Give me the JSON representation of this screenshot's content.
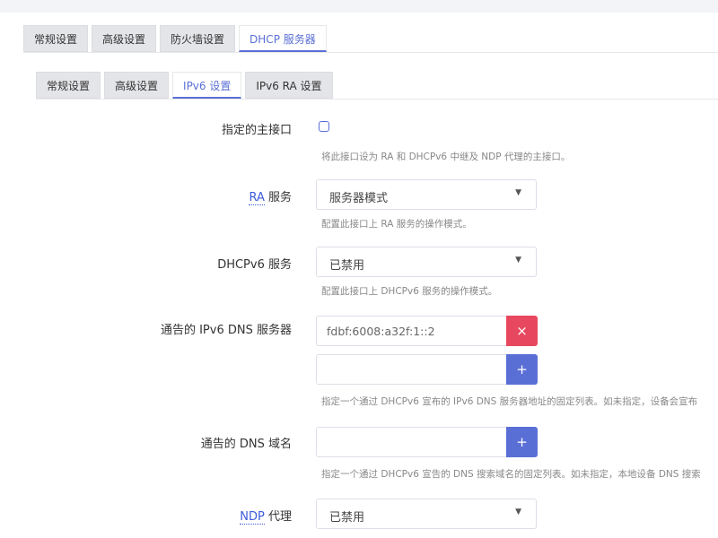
{
  "tabs_main": [
    {
      "label": "常规设置",
      "active": false
    },
    {
      "label": "高级设置",
      "active": false
    },
    {
      "label": "防火墙设置",
      "active": false
    },
    {
      "label": "DHCP 服务器",
      "active": true
    }
  ],
  "tabs_sub": [
    {
      "label": "常规设置",
      "active": false
    },
    {
      "label": "高级设置",
      "active": false
    },
    {
      "label": "IPv6 设置",
      "active": true
    },
    {
      "label": "IPv6 RA 设置",
      "active": false
    }
  ],
  "master_interface": {
    "label": "指定的主接口",
    "checked": false,
    "description": "将此接口设为 RA 和 DHCPv6 中继及 NDP 代理的主接口。"
  },
  "ra_service": {
    "label_abbr": "RA",
    "label_rest": " 服务",
    "value": "服务器模式",
    "description": "配置此接口上 RA 服务的操作模式。"
  },
  "dhcpv6_service": {
    "label": "DHCPv6 服务",
    "value": "已禁用",
    "description": "配置此接口上 DHCPv6 服务的操作模式。"
  },
  "dns_servers": {
    "label": "通告的 IPv6 DNS 服务器",
    "entries": [
      "fdbf:6008:a32f:1::2"
    ],
    "new_value": "",
    "remove_symbol": "×",
    "add_symbol": "+",
    "description": "指定一个通过 DHCPv6 宣布的 IPv6 DNS 服务器地址的固定列表。如未指定，设备会宣布"
  },
  "dns_domains": {
    "label": "通告的 DNS 域名",
    "new_value": "",
    "add_symbol": "+",
    "description": "指定一个通过 DHCPv6 宣告的 DNS 搜索域名的固定列表。如未指定，本地设备 DNS 搜索"
  },
  "ndp_proxy": {
    "label_abbr": "NDP",
    "label_rest": " 代理",
    "value": "已禁用"
  },
  "caret_symbol": "▼",
  "colors": {
    "accent": "#5a6fd6",
    "danger": "#e74860",
    "link": "#3d5bd9"
  }
}
